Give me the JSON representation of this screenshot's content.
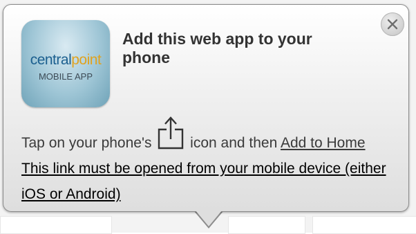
{
  "app_icon": {
    "brand_main": "central",
    "brand_accent": "point",
    "subtitle": "MOBILE APP"
  },
  "popup": {
    "title": "Add this web app to your phone",
    "close_icon": "close-icon",
    "instruction_prefix": "Tap on your phone's",
    "share_icon": "share-icon",
    "instruction_middle": "icon and then",
    "add_to_home_link": "Add to Home",
    "warning_text": "This link must be opened from your mobile device (either iOS or Android)"
  },
  "colors": {
    "brand_blue": "#1b5f8f",
    "brand_gold": "#e0a21f",
    "text": "#3a3a3a"
  }
}
